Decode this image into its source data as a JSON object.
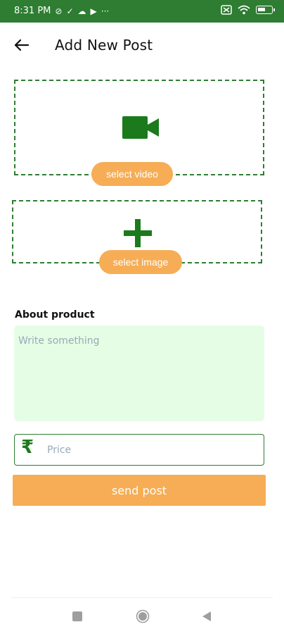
{
  "status_bar": {
    "time": "8:31 PM",
    "left_icons": [
      "data-saver-icon",
      "check-icon",
      "cloud-icon",
      "youtube-icon",
      "more-dots-icon"
    ],
    "right_icons": [
      "sim-off-icon",
      "wifi-icon",
      "battery-icon"
    ]
  },
  "header": {
    "title": "Add New Post",
    "back_icon": "arrow-left-icon"
  },
  "video_picker": {
    "icon": "video-camera-icon",
    "button_label": "select video"
  },
  "image_picker": {
    "icon": "plus-icon",
    "button_label": "select image"
  },
  "about": {
    "label": "About product",
    "placeholder": "Write something",
    "value": ""
  },
  "price": {
    "icon": "rupee-icon",
    "symbol": "₹",
    "placeholder": "Price",
    "value": ""
  },
  "send_button": {
    "label": "send post"
  },
  "nav_bar": {
    "items": [
      "recent-apps-icon",
      "home-icon",
      "back-icon"
    ]
  },
  "colors": {
    "primary_green": "#2e7d32",
    "icon_green": "#1b7a1b",
    "accent_orange": "#f6ad55",
    "textarea_bg": "#e6fde5"
  }
}
